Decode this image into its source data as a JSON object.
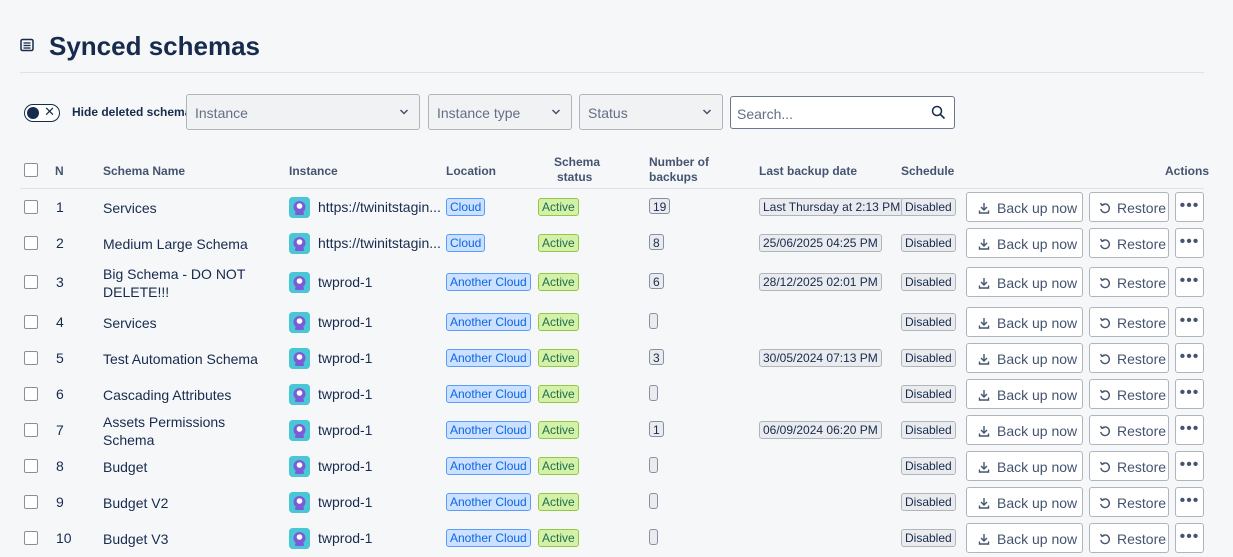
{
  "page": {
    "title": "Synced schemas"
  },
  "filters": {
    "toggle_label": "Hide deleted schemas",
    "instance_placeholder": "Instance",
    "instance_type_placeholder": "Instance type",
    "status_placeholder": "Status",
    "search_placeholder": "Search..."
  },
  "table": {
    "headers": {
      "n": "N",
      "name": "Schema Name",
      "instance": "Instance",
      "location": "Location",
      "status_line1": "Schema",
      "status_line2": "status",
      "backups_line1": "Number of",
      "backups_line2": "backups",
      "last_backup": "Last backup date",
      "schedule": "Schedule",
      "actions": "Actions"
    },
    "buttons": {
      "back_up": "Back up now",
      "restore": "Restore",
      "more": "•••"
    },
    "rows": [
      {
        "n": "1",
        "name": "Services",
        "instance": "https://twinitstagin...",
        "location": "Cloud",
        "status": "Active",
        "backups": "19",
        "last_backup": "Last Thursday at 2:13 PM",
        "schedule": "Disabled"
      },
      {
        "n": "2",
        "name": "Medium Large Schema",
        "instance": "https://twinitstagin...",
        "location": "Cloud",
        "status": "Active",
        "backups": "8",
        "last_backup": "25/06/2025 04:25 PM",
        "schedule": "Disabled"
      },
      {
        "n": "3",
        "name": "Big Schema - DO NOT DELETE!!!",
        "instance": "twprod-1",
        "location": "Another Cloud",
        "status": "Active",
        "backups": "6",
        "last_backup": "28/12/2025 02:01 PM",
        "schedule": "Disabled"
      },
      {
        "n": "4",
        "name": "Services",
        "instance": "twprod-1",
        "location": "Another Cloud",
        "status": "Active",
        "backups": "",
        "last_backup": "",
        "schedule": "Disabled"
      },
      {
        "n": "5",
        "name": "Test Automation Schema",
        "instance": "twprod-1",
        "location": "Another Cloud",
        "status": "Active",
        "backups": "3",
        "last_backup": "30/05/2024 07:13 PM",
        "schedule": "Disabled"
      },
      {
        "n": "6",
        "name": "Cascading Attributes",
        "instance": "twprod-1",
        "location": "Another Cloud",
        "status": "Active",
        "backups": "",
        "last_backup": "",
        "schedule": "Disabled"
      },
      {
        "n": "7",
        "name": "Assets Permissions Schema",
        "instance": "twprod-1",
        "location": "Another Cloud",
        "status": "Active",
        "backups": "1",
        "last_backup": "06/09/2024 06:20 PM",
        "schedule": "Disabled"
      },
      {
        "n": "8",
        "name": "Budget",
        "instance": "twprod-1",
        "location": "Another Cloud",
        "status": "Active",
        "backups": "",
        "last_backup": "",
        "schedule": "Disabled"
      },
      {
        "n": "9",
        "name": "Budget V2",
        "instance": "twprod-1",
        "location": "Another Cloud",
        "status": "Active",
        "backups": "",
        "last_backup": "",
        "schedule": "Disabled"
      },
      {
        "n": "10",
        "name": "Budget V3",
        "instance": "twprod-1",
        "location": "Another Cloud",
        "status": "Active",
        "backups": "",
        "last_backup": "",
        "schedule": "Disabled"
      }
    ]
  },
  "icons": {
    "menu": "list-icon",
    "chevron": "chevron-down-icon",
    "search": "search-icon",
    "instance": "instance-avatar-icon",
    "backup": "download-icon",
    "restore": "restore-icon"
  }
}
